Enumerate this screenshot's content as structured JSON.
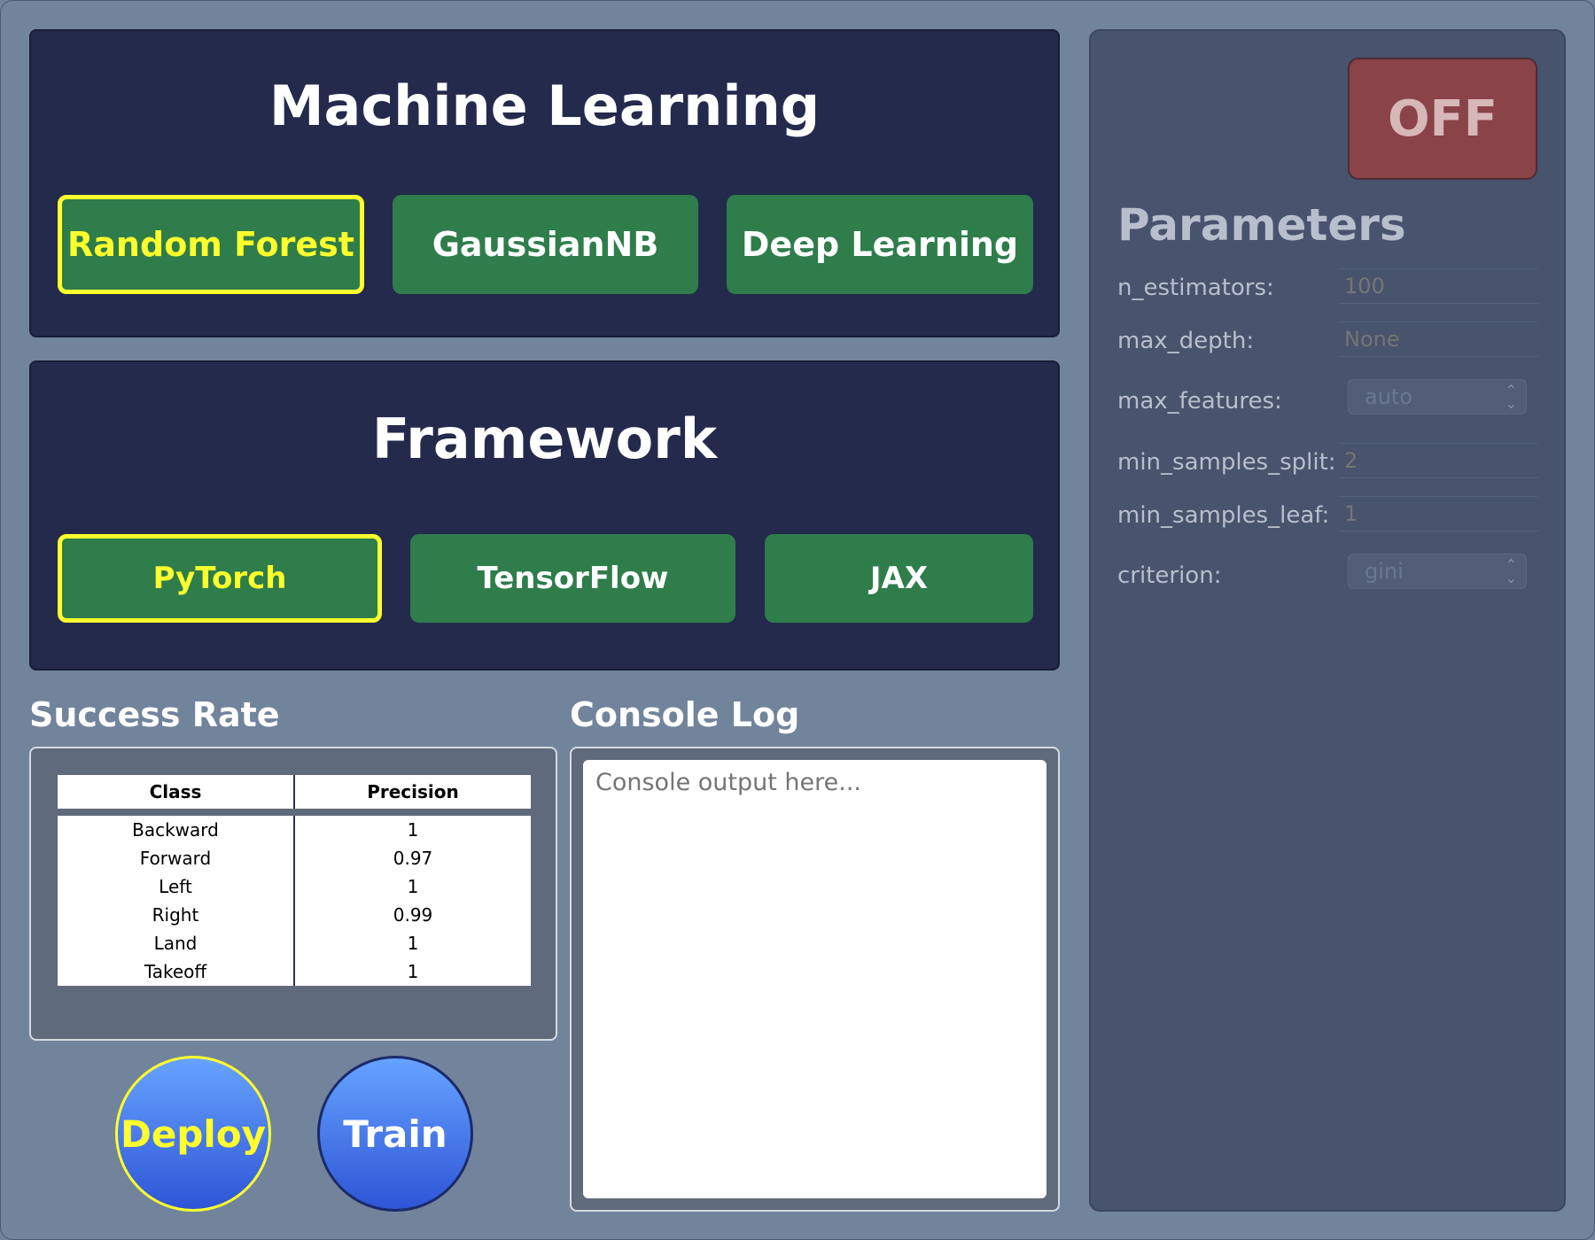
{
  "ml_panel": {
    "title": "Machine Learning",
    "options": [
      {
        "label": "Random Forest",
        "selected": true
      },
      {
        "label": "GaussianNB",
        "selected": false
      },
      {
        "label": "Deep Learning",
        "selected": false
      }
    ]
  },
  "framework_panel": {
    "title": "Framework",
    "options": [
      {
        "label": "PyTorch",
        "selected": true
      },
      {
        "label": "TensorFlow",
        "selected": false
      },
      {
        "label": "JAX",
        "selected": false
      }
    ]
  },
  "success_rate": {
    "title": "Success Rate",
    "columns": [
      "Class",
      "Precision"
    ],
    "rows": [
      [
        "Backward",
        "1"
      ],
      [
        "Forward",
        "0.97"
      ],
      [
        "Left",
        "1"
      ],
      [
        "Right",
        "0.99"
      ],
      [
        "Land",
        "1"
      ],
      [
        "Takeoff",
        "1"
      ]
    ]
  },
  "console": {
    "title": "Console Log",
    "placeholder": "Console output here..."
  },
  "actions": {
    "deploy_label": "Deploy",
    "train_label": "Train"
  },
  "power": {
    "label": "OFF"
  },
  "parameters": {
    "title": "Parameters",
    "fields": [
      {
        "label": "n_estimators:",
        "value": "100",
        "kind": "input"
      },
      {
        "label": "max_depth:",
        "value": "None",
        "kind": "input"
      },
      {
        "label": "max_features:",
        "value": "auto",
        "kind": "select"
      },
      {
        "label": "min_samples_split:",
        "value": "2",
        "kind": "input"
      },
      {
        "label": "min_samples_leaf:",
        "value": "1",
        "kind": "input"
      },
      {
        "label": "criterion:",
        "value": "gini",
        "kind": "select"
      }
    ]
  },
  "colors": {
    "panel_bg": "#232a4c",
    "option_green": "#2e7d4b",
    "selected_yellow": "#ffff2e",
    "page_bg": "#71849b",
    "off_red": "#8a4348"
  }
}
